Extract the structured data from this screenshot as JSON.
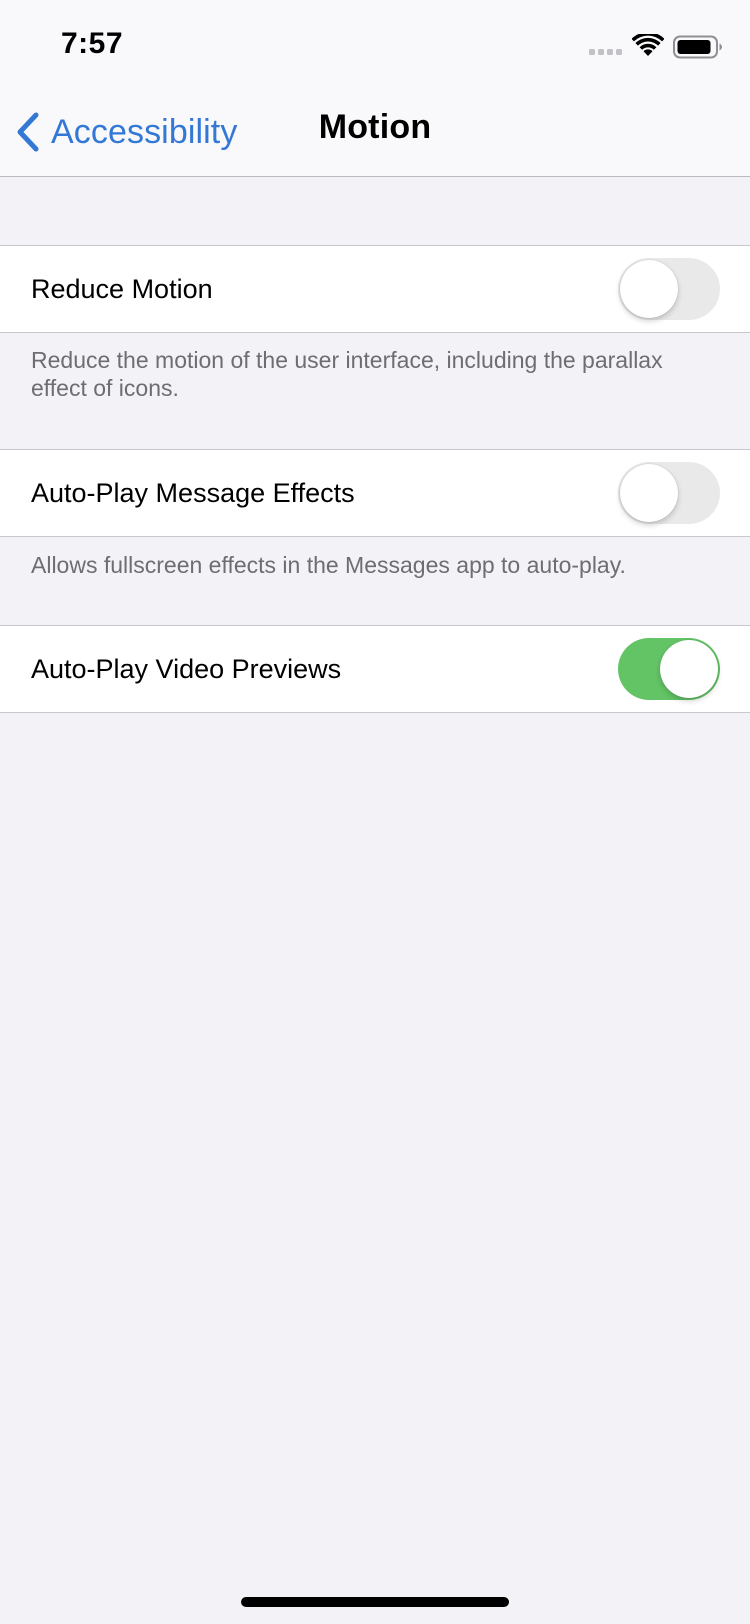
{
  "status_bar": {
    "time": "7:57",
    "icons": [
      "cellular-signal-icon",
      "wifi-icon",
      "battery-icon"
    ]
  },
  "nav": {
    "back_label": "Accessibility",
    "back_icon": "chevron-left-icon",
    "title": "Motion"
  },
  "colors": {
    "accent": "#3478D6",
    "toggle_on": "#63C466",
    "toggle_off": "#E9E9EA",
    "group_background": "#F2F2F7",
    "footer_text": "#6D6D72"
  },
  "settings": [
    {
      "label": "Reduce Motion",
      "enabled": false,
      "footer": "Reduce the motion of the user interface, including the parallax effect of icons."
    },
    {
      "label": "Auto-Play Message Effects",
      "enabled": false,
      "footer": "Allows fullscreen effects in the Messages app to auto-play."
    },
    {
      "label": "Auto-Play Video Previews",
      "enabled": true,
      "footer": ""
    }
  ]
}
